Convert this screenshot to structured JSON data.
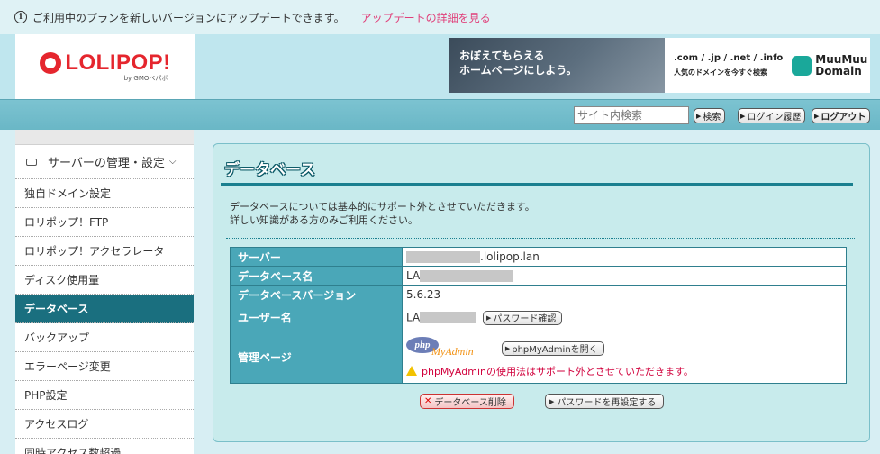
{
  "notice": {
    "text": "ご利用中のプランを新しいバージョンにアップデートできます。",
    "link": "アップデートの詳細を見る"
  },
  "header": {
    "logo_text": "LOLIPOP!",
    "logo_sub": "by GMOペパボ",
    "banner_left": "おぼえてもらえる\nホームページにしよう。",
    "banner_tlds": ".com / .jp / .net / .info",
    "banner_caption": "人気のドメインを今すぐ検索",
    "banner_brand": "MuuMuu\nDomain"
  },
  "nav": {
    "search_placeholder": "サイト内検索",
    "search_button": "検索",
    "login_history": "ログイン履歴",
    "logout": "ログアウト"
  },
  "sidebar": {
    "heading": "サーバーの管理・設定",
    "items": [
      {
        "label": "独自ドメイン設定"
      },
      {
        "label": "ロリポップ！FTP"
      },
      {
        "label": "ロリポップ！アクセラレータ"
      },
      {
        "label": "ディスク使用量"
      },
      {
        "label": "データベース"
      },
      {
        "label": "バックアップ"
      },
      {
        "label": "エラーページ変更"
      },
      {
        "label": "PHP設定"
      },
      {
        "label": "アクセスログ"
      },
      {
        "label": "同時アクセス数超過"
      }
    ]
  },
  "main": {
    "title": "データベース",
    "desc_1": "データベースについては基本的にサポート外とさせていただきます。",
    "desc_2": "詳しい知識がある方のみご利用ください。",
    "rows": {
      "server_label": "サーバー",
      "server_value": ".lolipop.lan",
      "dbname_label": "データベース名",
      "dbname_value": "LA",
      "version_label": "データベースバージョン",
      "version_value": "5.6.23",
      "user_label": "ユーザー名",
      "user_value": "LA",
      "password_check": "パスワード確認",
      "admin_label": "管理ページ",
      "pma_logo_php": "php",
      "pma_logo_my": "MyAdmin",
      "pma_open": "phpMyAdminを開く",
      "pma_warning": "phpMyAdminの使用法はサポート外とさせていただきます。"
    },
    "delete_button": "データベース削除",
    "reset_password_button": "パスワードを再設定する"
  }
}
